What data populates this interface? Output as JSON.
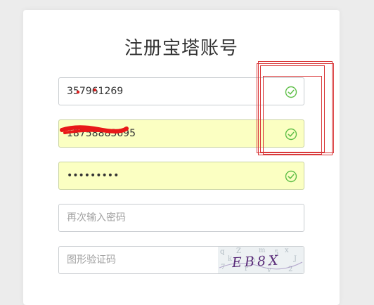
{
  "page": {
    "title": "注册宝塔账号"
  },
  "form": {
    "username": {
      "value": "357961269"
    },
    "phone": {
      "value": "18758883695"
    },
    "password": {
      "value": "password1"
    },
    "confirm_password": {
      "placeholder": "再次输入密码"
    },
    "captcha": {
      "placeholder": "图形验证码",
      "image_text": "EB8X"
    }
  },
  "colors": {
    "check_green": "#5fbf48",
    "autofill_yellow": "#fbffc2",
    "annotation_red": "#d9383a"
  },
  "icons": {
    "valid": "check-circle-icon"
  }
}
